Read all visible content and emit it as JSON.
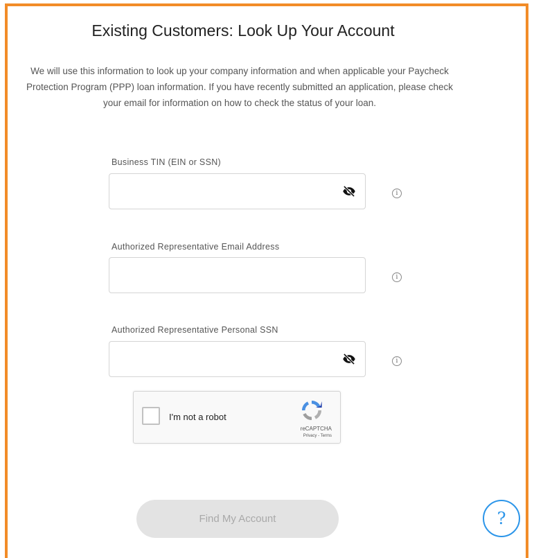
{
  "page": {
    "title": "Existing Customers: Look Up Your Account",
    "description": "We will use this information to look up your company information and when applicable your Paycheck Protection Program (PPP) loan information. If you have recently submitted an application, please check your email for information on how to check the status of your loan."
  },
  "form": {
    "fields": [
      {
        "label": "Business TIN (EIN or SSN)",
        "value": "",
        "placeholder": "",
        "masked": true,
        "info_icon": "info-icon",
        "toggle_icon": "eye-slash-icon"
      },
      {
        "label": "Authorized Representative Email Address",
        "value": "",
        "placeholder": "",
        "masked": false,
        "info_icon": "info-icon"
      },
      {
        "label": "Authorized Representative Personal SSN",
        "value": "",
        "placeholder": "",
        "masked": true,
        "info_icon": "info-icon",
        "toggle_icon": "eye-slash-icon"
      }
    ],
    "info_glyph": "i"
  },
  "captcha": {
    "label": "I'm not a robot",
    "brand": "reCAPTCHA",
    "links": "Privacy - Terms",
    "checked": false
  },
  "actions": {
    "submit_label": "Find My Account",
    "submit_disabled": true,
    "help_label": "?"
  },
  "colors": {
    "frame_border": "#f28c28",
    "help_accent": "#2b95e9",
    "button_disabled_bg": "#e3e3e3",
    "button_disabled_text": "#a9a9a9"
  }
}
